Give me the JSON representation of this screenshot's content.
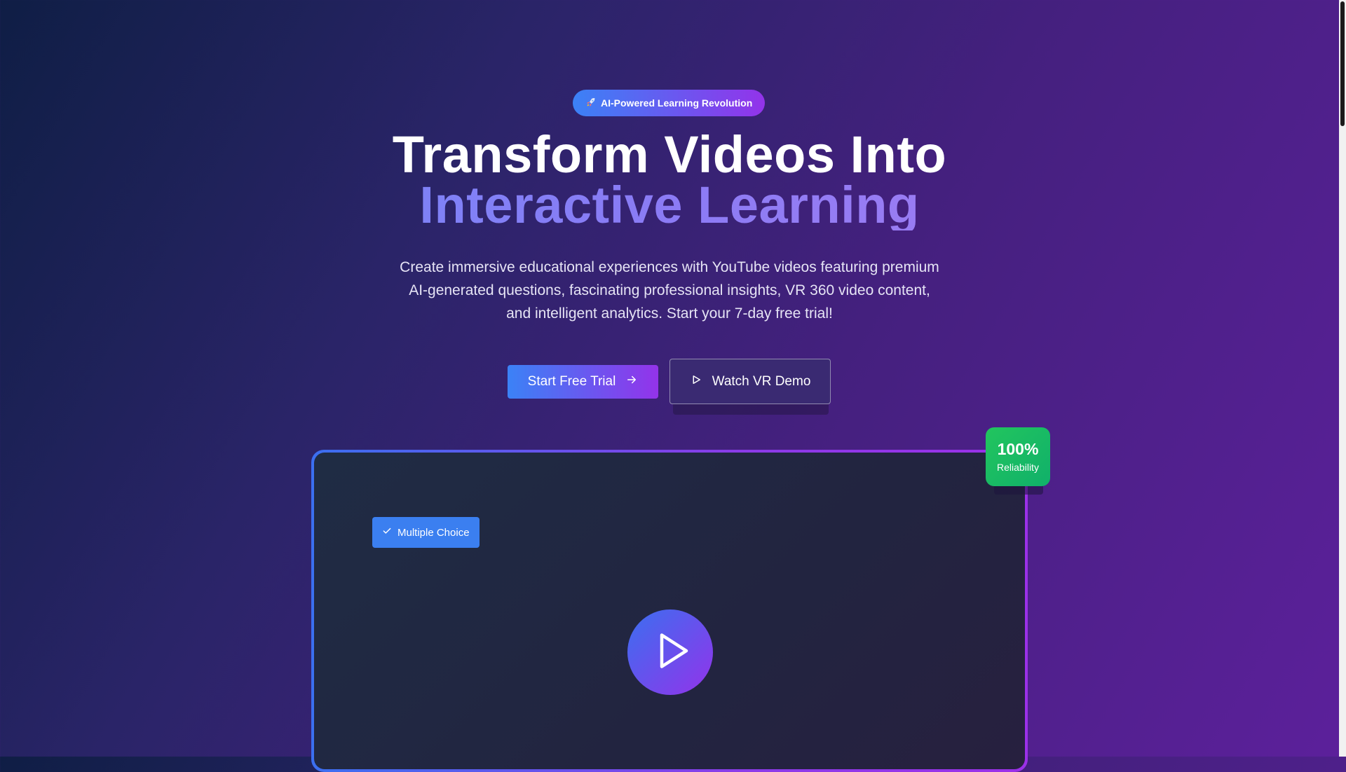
{
  "hero": {
    "badge_label": "AI-Powered Learning Revolution",
    "badge_icon": "rocket-icon",
    "title_line1": "Transform Videos Into",
    "title_line2": "Interactive Learning",
    "subtitle": "Create immersive educational experiences with YouTube videos featuring premium AI-generated questions, fascinating professional insights, VR 360 video content, and intelligent analytics. Start your 7-day free trial!"
  },
  "actions": {
    "primary_label": "Start Free Trial",
    "primary_icon": "arrow-right-icon",
    "secondary_label": "Watch VR Demo",
    "secondary_icon": "play-icon"
  },
  "preview": {
    "tag_label": "Multiple Choice",
    "tag_icon": "check-icon",
    "play_icon": "play-icon"
  },
  "stat": {
    "value": "100%",
    "label": "Reliability"
  },
  "colors": {
    "accent_blue": "#3b82f6",
    "accent_purple": "#9333ea",
    "success_green": "#22c55e"
  }
}
